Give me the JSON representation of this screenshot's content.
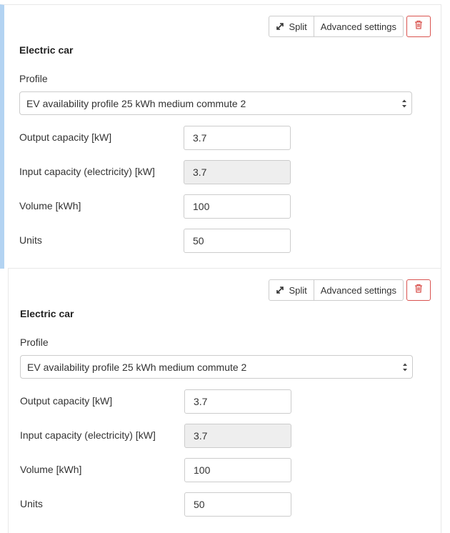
{
  "panels": [
    {
      "toolbar": {
        "split_label": "Split",
        "advanced_label": "Advanced settings"
      },
      "title": "Electric car",
      "profile_label": "Profile",
      "profile_value": "EV availability profile 25 kWh medium commute 2",
      "fields": [
        {
          "label": "Output capacity [kW]",
          "value": "3.7",
          "readonly": false
        },
        {
          "label": "Input capacity (electricity) [kW]",
          "value": "3.7",
          "readonly": true
        },
        {
          "label": "Volume [kWh]",
          "value": "100",
          "readonly": false
        },
        {
          "label": "Units",
          "value": "50",
          "readonly": false
        }
      ]
    },
    {
      "toolbar": {
        "split_label": "Split",
        "advanced_label": "Advanced settings"
      },
      "title": "Electric car",
      "profile_label": "Profile",
      "profile_value": "EV availability profile 25 kWh medium commute 2",
      "fields": [
        {
          "label": "Output capacity [kW]",
          "value": "3.7",
          "readonly": false
        },
        {
          "label": "Input capacity (electricity) [kW]",
          "value": "3.7",
          "readonly": true
        },
        {
          "label": "Volume [kWh]",
          "value": "100",
          "readonly": false
        },
        {
          "label": "Units",
          "value": "50",
          "readonly": false
        }
      ]
    }
  ],
  "icons": {
    "split": "expand-arrows-icon",
    "delete": "trash-icon",
    "select": "chevron-up-down-icon"
  },
  "colors": {
    "active_border": "#b3d3f2",
    "danger": "#d9534f",
    "readonly_bg": "#eeeeee"
  }
}
